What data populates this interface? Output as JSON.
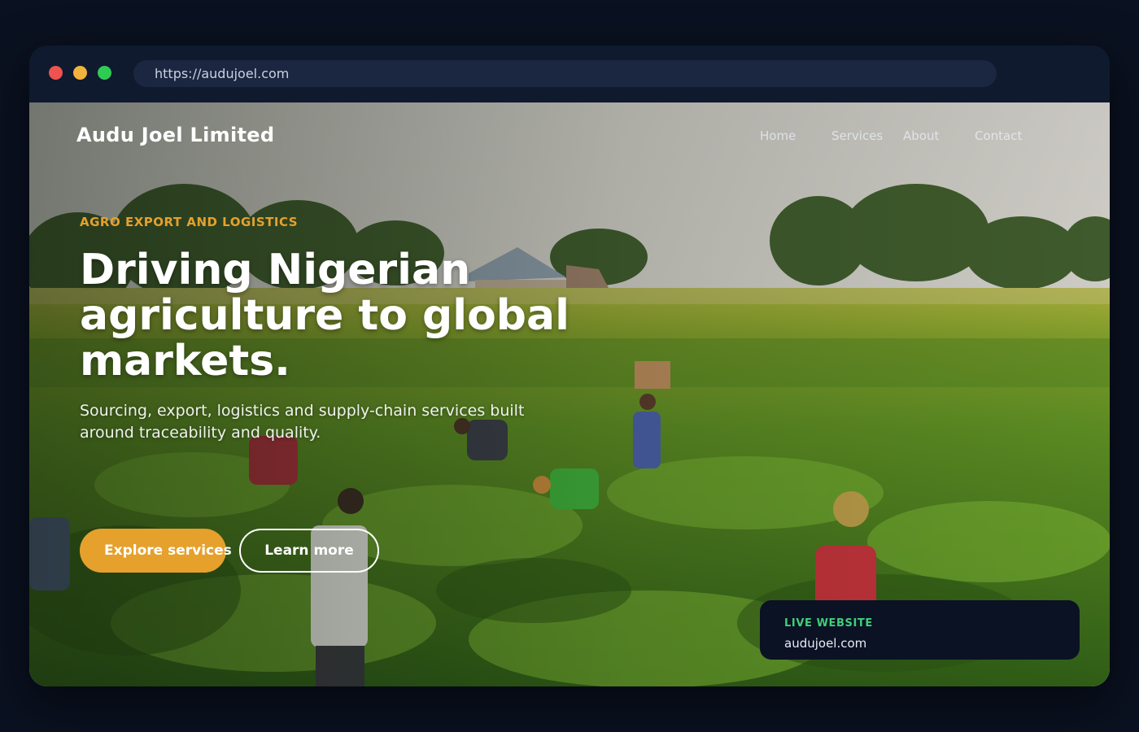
{
  "browser": {
    "url": "https://audujoel.com"
  },
  "site": {
    "brand": "Audu Joel Limited",
    "nav": [
      "Home",
      "Services",
      "About",
      "Contact"
    ]
  },
  "hero": {
    "eyebrow": "AGRO EXPORT AND LOGISTICS",
    "headline": "Driving Nigerian agriculture to global markets.",
    "subtitle": "Sourcing, export, logistics and supply-chain services built around traceability and quality.",
    "primary_button": "Explore services",
    "secondary_button": "Learn more"
  },
  "live_card": {
    "label": "LIVE WEBSITE",
    "domain": "audujoel.com"
  },
  "colors": {
    "accent": "#e5a12c",
    "live_green": "#3fd07a",
    "page_bg": "#0a1120",
    "chrome_bg": "#0f1a2e"
  }
}
